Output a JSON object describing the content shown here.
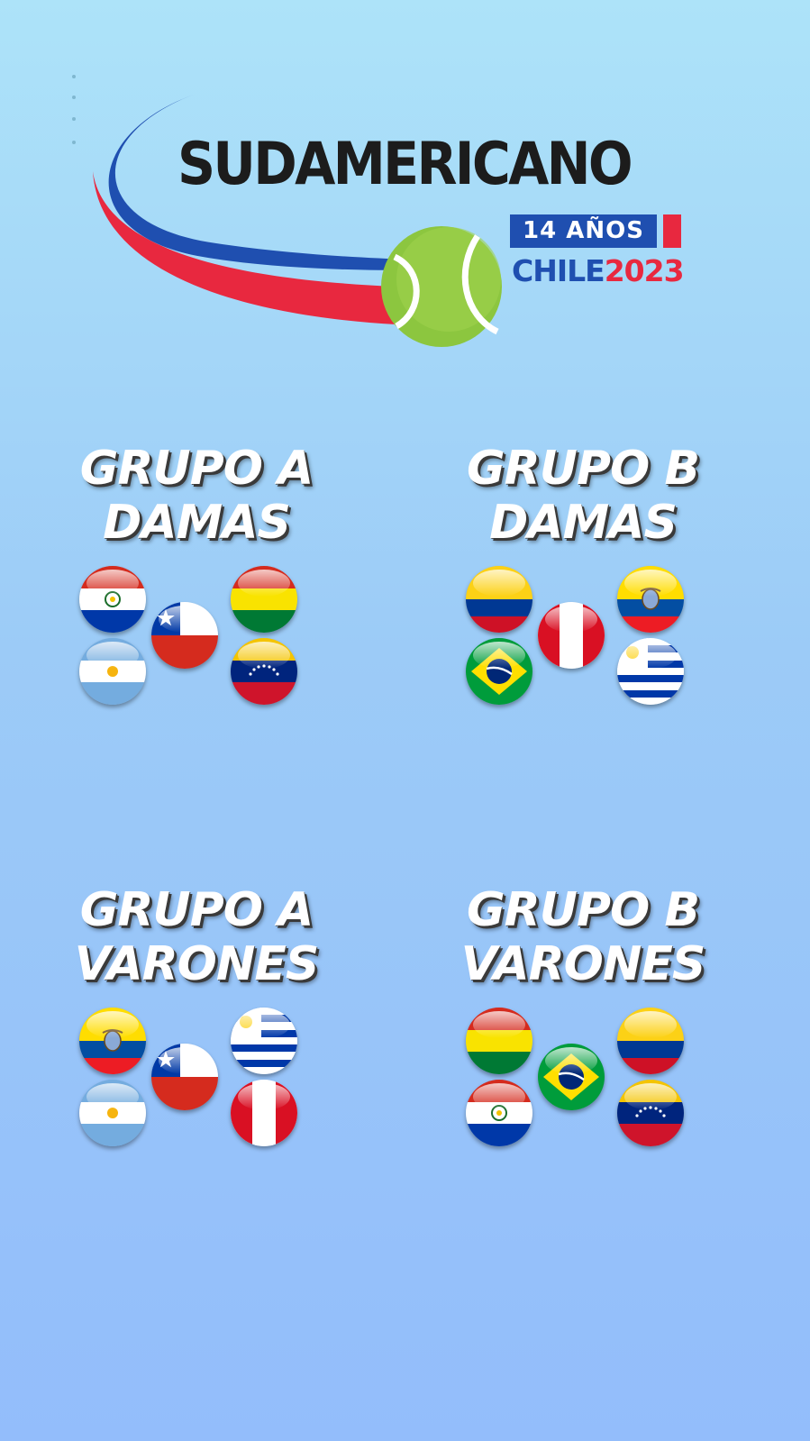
{
  "logo": {
    "title": "SUDAMERICANO",
    "badge": "14 AÑOS",
    "country": "CHILE",
    "year": "2023",
    "colors": {
      "blue": "#1f4fb0",
      "red": "#e8283f",
      "ball": "#8cc63f",
      "text": "#1c1c1c"
    }
  },
  "groups": [
    {
      "line1": "GRUPO A",
      "line2": "DAMAS",
      "flags": [
        "paraguay",
        "argentina",
        "chile",
        "bolivia",
        "venezuela"
      ]
    },
    {
      "line1": "GRUPO B",
      "line2": "DAMAS",
      "flags": [
        "colombia",
        "brazil",
        "peru",
        "ecuador",
        "uruguay"
      ]
    },
    {
      "line1": "GRUPO A",
      "line2": "VARONES",
      "flags": [
        "ecuador",
        "argentina",
        "chile",
        "uruguay",
        "peru"
      ]
    },
    {
      "line1": "GRUPO B",
      "line2": "VARONES",
      "flags": [
        "bolivia",
        "paraguay",
        "brazil",
        "colombia",
        "venezuela"
      ]
    }
  ]
}
